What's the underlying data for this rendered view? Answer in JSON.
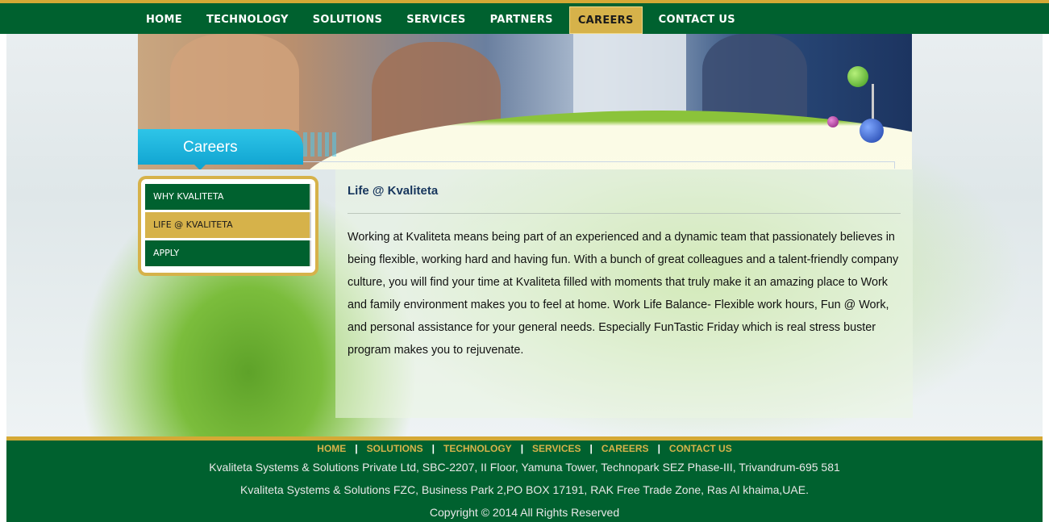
{
  "nav": {
    "items": [
      "HOME",
      "TECHNOLOGY",
      "SOLUTIONS",
      "SERVICES",
      "PARTNERS",
      "CAREERS",
      "CONTACT US"
    ]
  },
  "banner": {
    "section_title": "Careers"
  },
  "sidebar": {
    "items": [
      "WHY KVALITETA",
      "LIFE @ KVALITETA",
      "APPLY"
    ]
  },
  "content": {
    "heading": "Life @ Kvaliteta",
    "body": "Working at Kvaliteta means being part of an experienced and a dynamic team that passionately believes in being flexible, working hard and having fun. With a bunch of great colleagues and a talent-friendly company culture, you will find your time at Kvaliteta filled with moments that truly make it an amazing place to Work and family environment makes you to feel at home. Work Life Balance- Flexible work hours, Fun @ Work, and personal assistance for your general needs. Especially FunTastic Friday which is real stress buster program makes you to rejuvenate."
  },
  "footer": {
    "links": [
      "HOME",
      "SOLUTIONS",
      "TECHNOLOGY",
      "SERVICES",
      "CAREERS",
      "CONTACT US"
    ],
    "separator": "|",
    "address1": "Kvaliteta Systems & Solutions Private Ltd, SBC-2207, II Floor, Yamuna Tower, Technopark SEZ Phase-III, Trivandrum-695 581",
    "address2": "Kvaliteta Systems & Solutions FZC, Business Park 2,PO BOX 17191, RAK Free Trade Zone, Ras Al khaima,UAE.",
    "copyright": "Copyright © 2014 All Rights Reserved"
  },
  "colors": {
    "brand_green": "#00612f",
    "accent_gold": "#d6b24a",
    "careers_blue": "#12a6d2",
    "heading_navy": "#17365d"
  }
}
